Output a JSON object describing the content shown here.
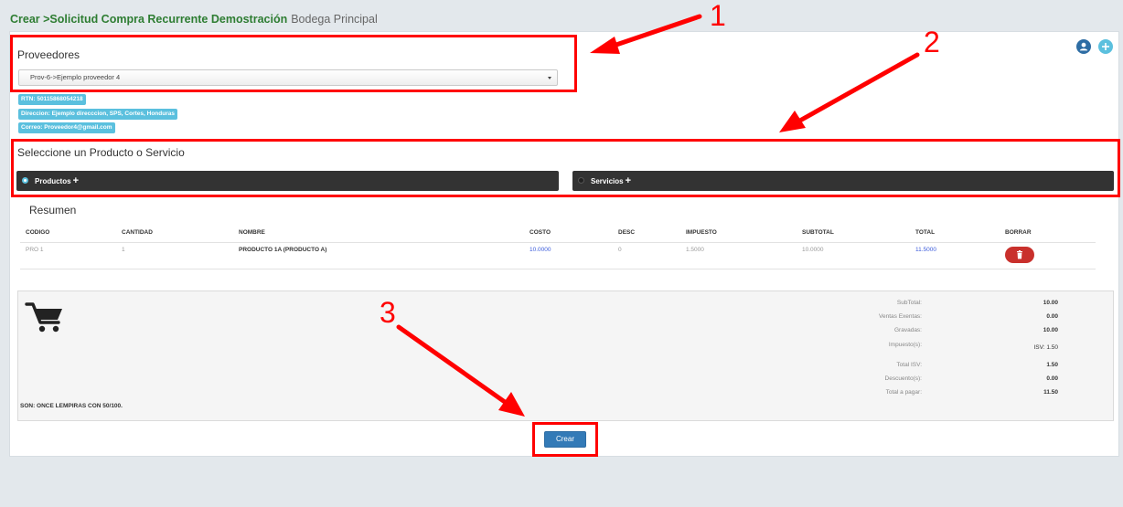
{
  "header": {
    "title": "Crear >Solicitud Compra Recurrente Demostración",
    "subtitle": "Bodega Principal"
  },
  "proveedores": {
    "title": "Proveedores",
    "selected": "Prov-6->Ejemplo proveedor 4",
    "rtn": "RTN: 50115868054218",
    "direccion": "Direccion: Ejemplo direcccion, SPS, Cortes, Honduras",
    "correo": "Correo: Proveedor4@gmail.com"
  },
  "selector": {
    "title": "Seleccione un Producto o Servicio",
    "productos_label": "Productos",
    "servicios_label": "Servicios",
    "plus": "+"
  },
  "resumen": {
    "title": "Resumen",
    "columns": [
      "CODIGO",
      "CANTIDAD",
      "NOMBRE",
      "COSTO",
      "DESC",
      "IMPUESTO",
      "SUBTOTAL",
      "TOTAL",
      "BORRAR"
    ],
    "rows": [
      [
        "PRO 1",
        "1",
        "PRODUCTO 1A (PRODUCTO A)",
        "10.0000",
        "0",
        "1.5000",
        "10.0000",
        "11.5000"
      ]
    ]
  },
  "totals": {
    "subtotal_label": "SubTotal:",
    "subtotal": "10.00",
    "exentas_label": "Ventas Exentas:",
    "exentas": "0.00",
    "gravadas_label": "Gravadas:",
    "gravadas": "10.00",
    "impuestos_label": "Impuesto(s):",
    "impuestos": "ISV: 1.50",
    "total_isv_label": "Total ISV:",
    "total_isv": "1.50",
    "descuentos_label": "Descuento(s):",
    "descuentos": "0.00",
    "total_pagar_label": "Total a pagar:",
    "total_pagar": "11.50",
    "son": "SON: ONCE LEMPIRAS CON 50/100."
  },
  "actions": {
    "crear": "Crear"
  },
  "annotations": {
    "one": "1",
    "two": "2",
    "three": "3"
  },
  "icons": [
    "user-icon",
    "plus-icon",
    "cart-icon",
    "trash-icon"
  ],
  "colors": {
    "accent_green": "#2e7d32",
    "info": "#5bc0de",
    "dark_bar": "#333333",
    "primary": "#337ab7",
    "danger": "#c9302c",
    "annotation_red": "#ff0000",
    "link_blue": "#3b5bdb"
  }
}
